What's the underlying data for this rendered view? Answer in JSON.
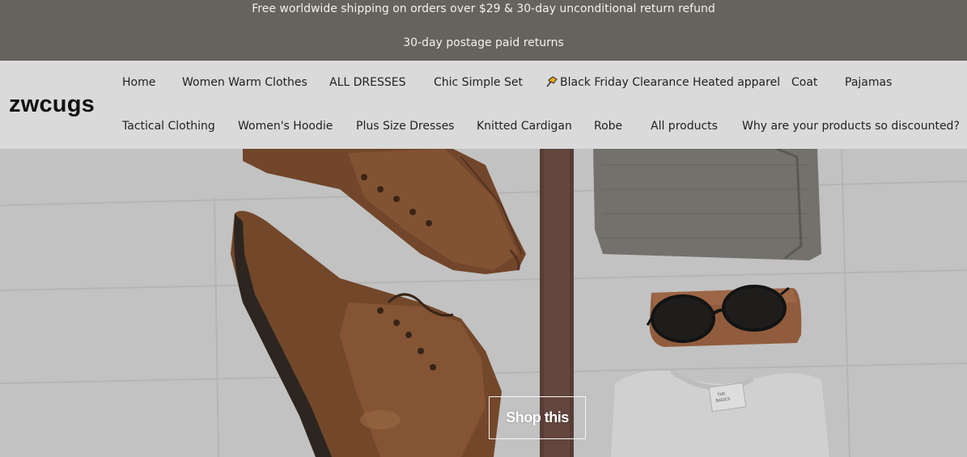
{
  "announcement": {
    "line1": "Free worldwide shipping on orders over $29 & 30-day unconditional return refund",
    "line2": "30-day postage paid returns"
  },
  "header": {
    "logo": "zwcugs",
    "nav_row1": [
      "Home",
      "Women Warm Clothes",
      "ALL DRESSES",
      "Chic Simple Set",
      "Black Friday Clearance Heated apparel",
      "Coat",
      "Pajamas"
    ],
    "nav_row2": [
      "Tactical Clothing",
      "Women's Hoodie",
      "Plus Size Dresses",
      "Knitted Cardigan",
      "Robe",
      "All products",
      "Why are your products so discounted?"
    ],
    "pin_icon": "pushpin-icon"
  },
  "hero": {
    "image_icon": "flatlay-photo",
    "button_label": "Shop this"
  },
  "colors": {
    "announcement_bg": "#66635d",
    "header_bg": "#dadada",
    "hero_bg": "#d3d3d3"
  }
}
